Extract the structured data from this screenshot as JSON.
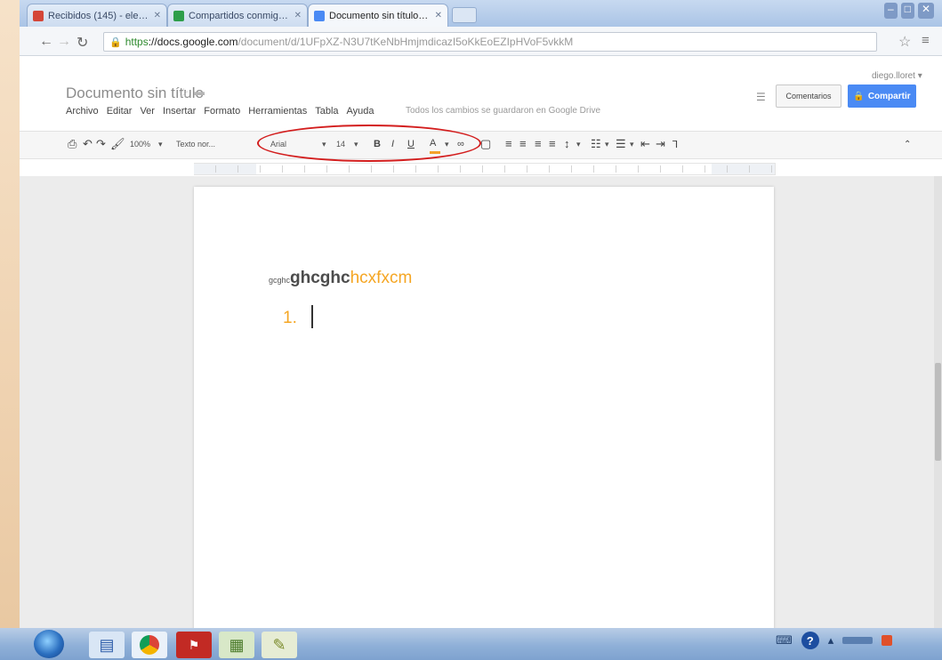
{
  "tabs": [
    {
      "label": "Recibidos (145) - elegan…",
      "favicon_color": "#d44638"
    },
    {
      "label": "Compartidos conmigo - …",
      "favicon_color": "#2e9e4a"
    },
    {
      "label": "Documento sin título - G…",
      "favicon_color": "#4a8af4"
    }
  ],
  "address": {
    "https": "https",
    "host": "://docs.google.com",
    "path": "/document/d/1UFpXZ-N3U7tKeNbHmjmdicazI5oKkEoEZIpHVoF5vkkM"
  },
  "doc": {
    "title": "Documento sin título",
    "menu": [
      "Archivo",
      "Editar",
      "Ver",
      "Insertar",
      "Formato",
      "Herramientas",
      "Tabla",
      "Ayuda"
    ],
    "save_status": "Todos los cambios se guardaron en Google Drive",
    "user_email": "diego.lloret ▾",
    "comments_label": "Comentarios",
    "share_label": "Compartir"
  },
  "toolbar": {
    "zoom": "100%",
    "style": "Texto nor...",
    "font": "Arial",
    "size": "14"
  },
  "content": {
    "small_run": "gcghc",
    "bold_run": "ghcghc",
    "orange_run": "hcxfxcm",
    "list_number": "1."
  },
  "colors": {
    "text_orange": "#f5a623",
    "share_blue": "#4a8af4",
    "highlight_red": "#d31e1e"
  }
}
